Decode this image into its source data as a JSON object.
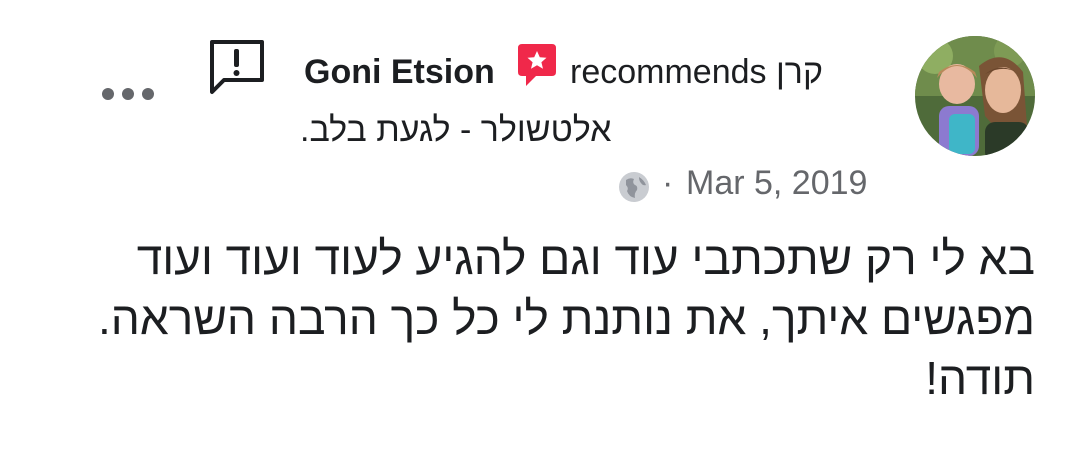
{
  "post": {
    "author": "Goni Etsion",
    "recommends_text": "recommends קרן",
    "recommended_page": "אלטשולר - לגעת בלב.",
    "separator": "·",
    "date": "Mar 5, 2019",
    "body": "בא לי רק שתכתבי עוד וגם להגיע לעוד ועוד ועוד מפגשים איתך, את נותנת לי כל כך הרבה השראה. תודה!",
    "icons": {
      "recommend": "recommend-star-bubble-icon",
      "privacy": "globe-icon",
      "feedback": "feedback-exclamation-icon",
      "more": "more-dots-icon"
    },
    "colors": {
      "recommend_red": "#f0284a",
      "meta_gray": "#65676b",
      "text": "#1c1e21"
    }
  }
}
